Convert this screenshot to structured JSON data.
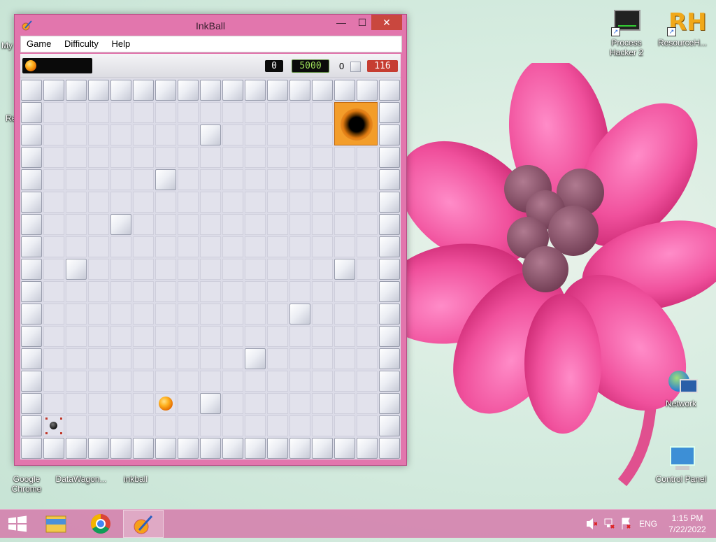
{
  "window": {
    "title": "InkBall",
    "minimize": "—",
    "maximize": "☐",
    "close": "✕"
  },
  "menu": [
    "Game",
    "Difficulty",
    "Help"
  ],
  "scorebar": {
    "score": "0",
    "time": "5000",
    "bricks": "0",
    "remaining": "116"
  },
  "desktop_icons": {
    "process_hacker": "Process Hacker 2",
    "resource_hacker": "ResourceH...",
    "network": "Network",
    "control_panel": "Control Panel",
    "google_chrome": "Google Chrome",
    "datawagon": "DataWagon...",
    "inkball": "inkball",
    "partial_my": "My",
    "partial_re": "Re"
  },
  "taskbar": {
    "language": "ENG",
    "time": "1:15 PM",
    "date": "7/22/2022"
  },
  "colors": {
    "window_frame": "#e276ad",
    "close_button": "#c9473e",
    "orange_hole": "#f39d2a",
    "taskbar": "#d678aa"
  }
}
